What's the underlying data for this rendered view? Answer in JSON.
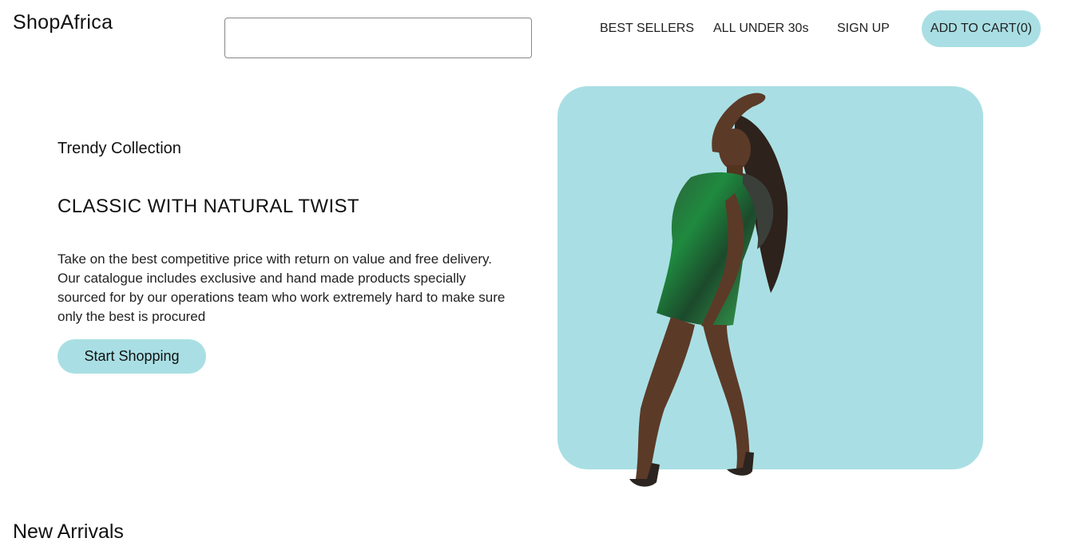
{
  "theme": {
    "accent": "#a9dfe4"
  },
  "header": {
    "logo": "ShopAfrica",
    "search": {
      "value": "",
      "placeholder": ""
    },
    "nav": [
      {
        "label": "BEST SELLERS"
      },
      {
        "label": "ALL UNDER 30s"
      },
      {
        "label": "SIGN UP"
      }
    ],
    "cart_label": "ADD TO CART(0)"
  },
  "hero": {
    "eyebrow": "Trendy Collection",
    "headline": "CLASSIC WITH NATURAL TWIST",
    "description": "Take on the best competitive price with return on value and free delivery. Our catalogue includes exclusive and hand made products specially sourced for by our operations team who work extremely hard to make sure only the best is procured",
    "cta_label": "Start Shopping",
    "image_subject": "model-in-green-sequin-dress"
  },
  "sections": {
    "new_arrivals_title": "New Arrivals"
  }
}
